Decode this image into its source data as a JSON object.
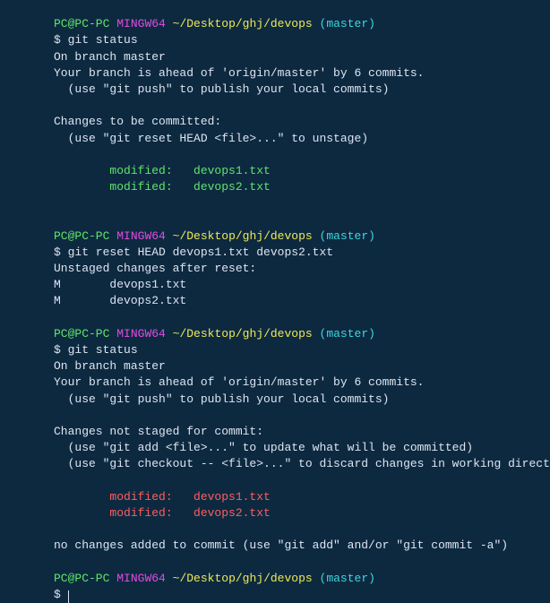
{
  "prompt": {
    "user": "PC@PC-PC",
    "mingw": "MINGW64",
    "path": "~/Desktop/ghj/devops",
    "open_paren": "(",
    "branch": "master",
    "close_paren": ")"
  },
  "block1": {
    "cmd": "$ git status",
    "l1": "On branch master",
    "l2": "Your branch is ahead of 'origin/master' by 6 commits.",
    "l3": "  (use \"git push\" to publish your local commits)",
    "l4": "Changes to be committed:",
    "l5": "  (use \"git reset HEAD <file>...\" to unstage)",
    "m1": "        modified:   devops1.txt",
    "m2": "        modified:   devops2.txt"
  },
  "block2": {
    "cmd": "$ git reset HEAD devops1.txt devops2.txt",
    "l1": "Unstaged changes after reset:",
    "l2": "M       devops1.txt",
    "l3": "M       devops2.txt"
  },
  "block3": {
    "cmd": "$ git status",
    "l1": "On branch master",
    "l2": "Your branch is ahead of 'origin/master' by 6 commits.",
    "l3": "  (use \"git push\" to publish your local commits)",
    "l4": "Changes not staged for commit:",
    "l5": "  (use \"git add <file>...\" to update what will be committed)",
    "l6": "  (use \"git checkout -- <file>...\" to discard changes in working directory)",
    "m1": "        modified:   devops1.txt",
    "m2": "        modified:   devops2.txt",
    "l7": "no changes added to commit (use \"git add\" and/or \"git commit -a\")"
  },
  "block4": {
    "cmd": "$ "
  }
}
